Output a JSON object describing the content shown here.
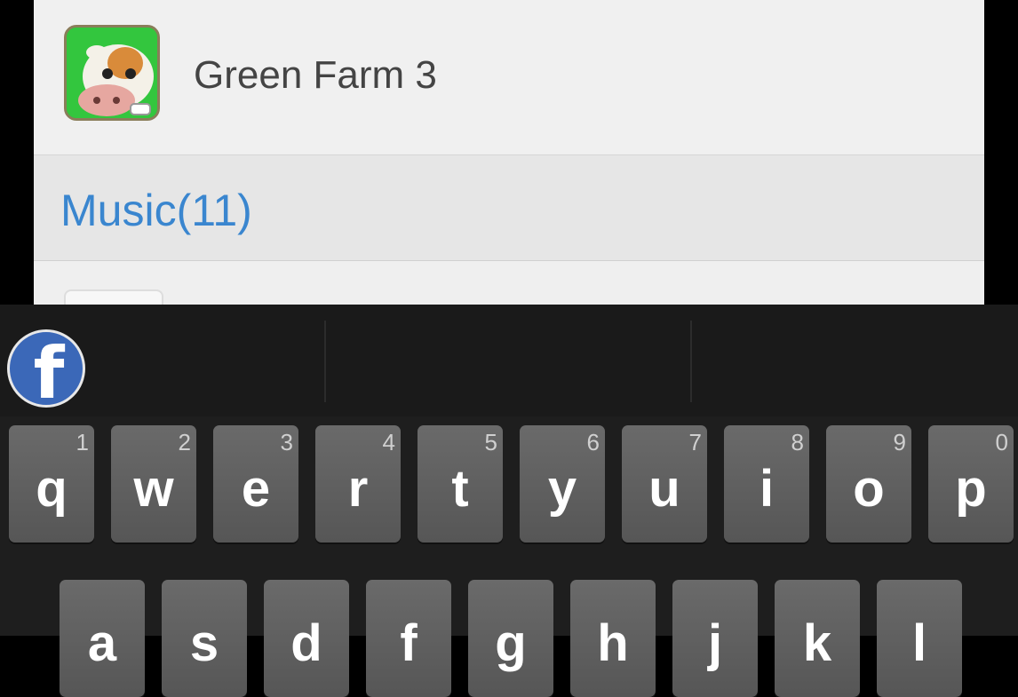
{
  "list": {
    "app": {
      "name": "Green Farm 3",
      "icon": "green-farm-app-icon"
    },
    "section": {
      "label": "Music(11)"
    }
  },
  "keyboard": {
    "suggestion_icon": "facebook-icon",
    "suggestion_glyph": "f",
    "row1": [
      {
        "letter": "q",
        "hint": "1"
      },
      {
        "letter": "w",
        "hint": "2"
      },
      {
        "letter": "e",
        "hint": "3"
      },
      {
        "letter": "r",
        "hint": "4"
      },
      {
        "letter": "t",
        "hint": "5"
      },
      {
        "letter": "y",
        "hint": "6"
      },
      {
        "letter": "u",
        "hint": "7"
      },
      {
        "letter": "i",
        "hint": "8"
      },
      {
        "letter": "o",
        "hint": "9"
      },
      {
        "letter": "p",
        "hint": "0"
      }
    ],
    "row2": [
      {
        "letter": "a"
      },
      {
        "letter": "s"
      },
      {
        "letter": "d"
      },
      {
        "letter": "f"
      },
      {
        "letter": "g"
      },
      {
        "letter": "h"
      },
      {
        "letter": "j"
      },
      {
        "letter": "k"
      },
      {
        "letter": "l"
      }
    ]
  },
  "colors": {
    "accent": "#3a86cf",
    "key": "#5f5f5f",
    "keyboard_bg": "#1e1e1e"
  }
}
